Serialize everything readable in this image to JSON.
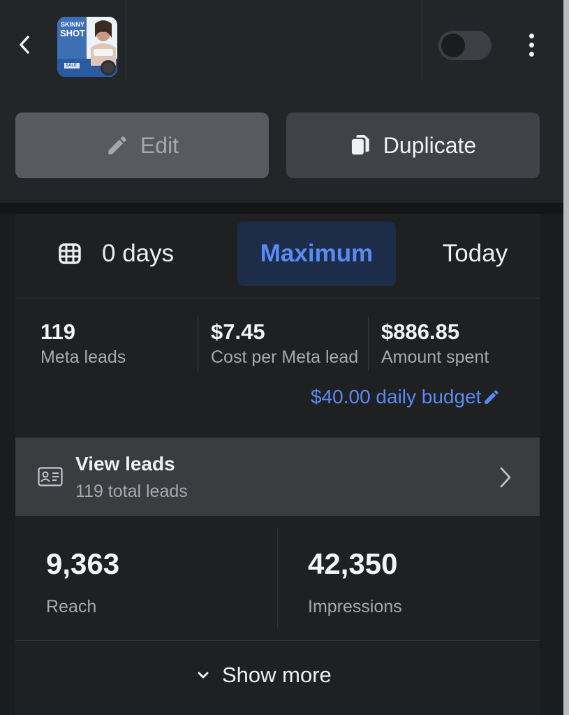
{
  "header": {
    "back_icon": "chevron-left-icon",
    "ad_thumbnail": {
      "text_line1": "SKINNY",
      "text_line2": "SHOT",
      "badge": "SALE"
    },
    "toggle": {
      "state": "off"
    },
    "more_icon": "kebab-menu-icon"
  },
  "actions": {
    "edit": {
      "label": "Edit",
      "icon": "pencil-icon"
    },
    "duplicate": {
      "label": "Duplicate",
      "icon": "copy-icon"
    }
  },
  "date_range": {
    "calendar_icon": "calendar-icon",
    "days_label": "0 days",
    "maximum_label": "Maximum",
    "today_label": "Today",
    "selected": "Maximum"
  },
  "metrics": [
    {
      "value": "119",
      "label": "Meta leads"
    },
    {
      "value": "$7.45",
      "label": "Cost per Meta lead"
    },
    {
      "value": "$886.85",
      "label": "Amount spent"
    }
  ],
  "budget": {
    "text": "$40.00 daily budget",
    "icon": "pencil-icon"
  },
  "view_leads": {
    "title": "View leads",
    "subtitle": "119 total leads",
    "icon": "contact-card-icon",
    "chevron_icon": "chevron-right-icon"
  },
  "stats": [
    {
      "value": "9,363",
      "label": "Reach"
    },
    {
      "value": "42,350",
      "label": "Impressions"
    }
  ],
  "show_more": {
    "label": "Show more",
    "icon": "chevron-down-icon"
  },
  "colors": {
    "accent_blue": "#5a8af4",
    "selected_tab_bg": "#1c2c49",
    "background": "#1b1c1d",
    "header_bg": "#232629"
  }
}
